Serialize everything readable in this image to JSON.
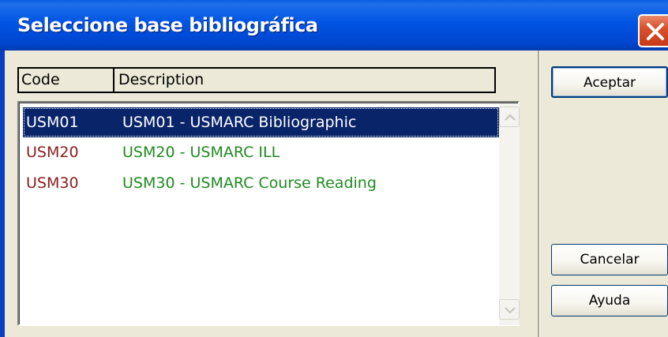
{
  "window": {
    "title": "Seleccione base bibliográfica"
  },
  "list": {
    "columns": [
      "Code",
      "Description"
    ],
    "rows": [
      {
        "code": "USM01",
        "description": "USM01 - USMARC Bibliographic",
        "selected": true
      },
      {
        "code": "USM20",
        "description": "USM20 - USMARC ILL",
        "selected": false
      },
      {
        "code": "USM30",
        "description": "USM30 - USMARC Course Reading",
        "selected": false
      }
    ]
  },
  "buttons": {
    "accept": "Aceptar",
    "cancel": "Cancelar",
    "help": "Ayuda"
  },
  "colors": {
    "titlebar": "#0054e3",
    "selection": "#0a246a",
    "code_text": "#8a1c1c",
    "description_text": "#1f8a1f",
    "dialog_bg": "#ece9d8"
  },
  "icons": {
    "close": "close-icon",
    "scroll_up": "scroll-up-arrow-icon",
    "scroll_down": "scroll-down-arrow-icon"
  }
}
